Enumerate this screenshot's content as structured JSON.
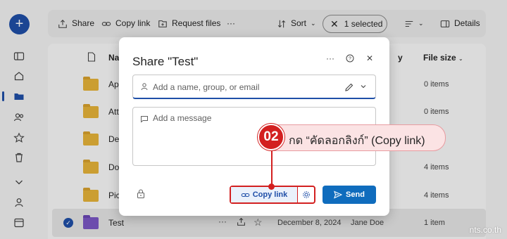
{
  "toolbar": {
    "share_label": "Share",
    "copy_link_label": "Copy link",
    "request_files_label": "Request files",
    "more_label": "···",
    "sort_label": "Sort",
    "selected_label": "1 selected",
    "details_label": "Details"
  },
  "list": {
    "headers": {
      "name": "Na",
      "modified_partial": "y",
      "size": "File size"
    },
    "rows": [
      {
        "name": "Ap",
        "size": "0 items"
      },
      {
        "name": "Att",
        "size": "0 items"
      },
      {
        "name": "De",
        "size": "s"
      },
      {
        "name": "Do",
        "size": "4 items"
      },
      {
        "name": "Pic",
        "size": "4 items"
      },
      {
        "name": "Test",
        "date": "December 8, 2024",
        "owner": "Jane Doe",
        "size": "1 item",
        "selected": true
      }
    ]
  },
  "dialog": {
    "title": "Share \"Test\"",
    "people_placeholder": "Add a name, group, or email",
    "message_placeholder": "Add a message",
    "copy_link_label": "Copy link",
    "send_label": "Send"
  },
  "annotation": {
    "step_number": "02",
    "text": "กด “คัดลอกลิงก์” (Copy link)",
    "color": "#d32020"
  },
  "watermark": "nts.co.th",
  "colors": {
    "accent": "#1f4fa8",
    "send": "#0f6cbd",
    "highlight": "#d32020"
  }
}
